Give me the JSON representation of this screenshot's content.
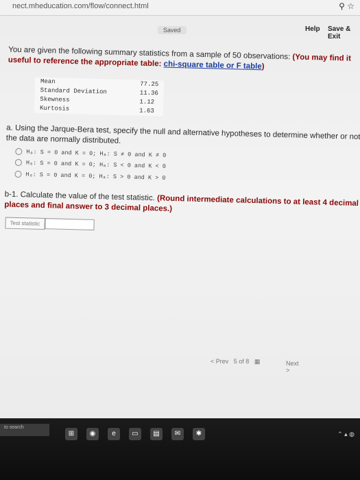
{
  "browser": {
    "url": "nect.mheducation.com/flow/connect.html"
  },
  "header": {
    "saved_label": "Saved",
    "help_label": "Help",
    "save_exit_label": "Save & Exit"
  },
  "question": {
    "intro_text": "You are given the following summary statistics from a sample of 50 observations:",
    "hint_prefix": "(You may find it useful to reference the appropriate table:",
    "hint_link": "chi-square table or F table",
    "hint_suffix": ")",
    "stats": [
      {
        "label": "Mean",
        "value": "77.25"
      },
      {
        "label": "Standard Deviation",
        "value": "11.36"
      },
      {
        "label": "Skewness",
        "value": "1.12"
      },
      {
        "label": "Kurtosis",
        "value": "1.63"
      }
    ]
  },
  "part_a": {
    "prompt": "a. Using the Jarque-Bera test, specify the null and alternative hypotheses to determine whether or not the data are normally distributed.",
    "options": [
      "H₀: S = 0 and K = 0; Hₐ: S ≠ 0 and K ≠ 0",
      "H₀: S = 0 and K = 0; Hₐ: S < 0 and K < 0",
      "H₀: S = 0 and K = 0; Hₐ: S > 0 and K > 0"
    ]
  },
  "part_b": {
    "prompt_prefix": "b-1. Calculate the value of the test statistic.",
    "prompt_bold": "(Round intermediate calculations to at least 4 decimal places and final answer to 3 decimal places.)",
    "test_statistic_label": "Test statistic",
    "test_statistic_value": ""
  },
  "navigation": {
    "prev_label": "Prev",
    "page_label": "5 of 8",
    "next_label": "Next"
  },
  "taskbar": {
    "search_placeholder": "to search"
  }
}
